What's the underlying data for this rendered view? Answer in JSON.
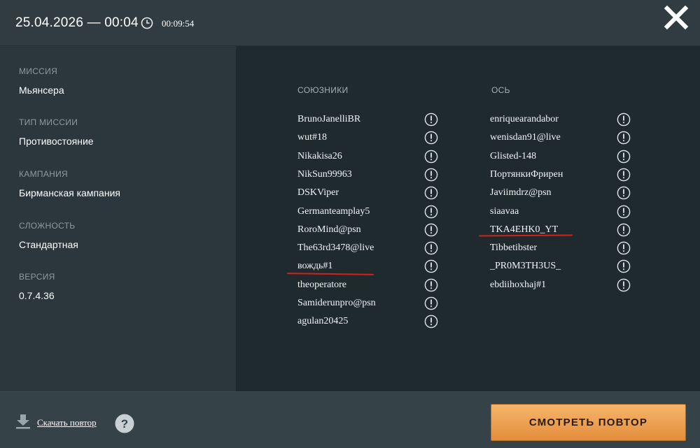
{
  "header": {
    "datetime": "25.04.2026 — 00:04",
    "duration": "00:09:54"
  },
  "info": [
    {
      "label": "МИССИЯ",
      "value": "Мьянсера"
    },
    {
      "label": "ТИП МИССИИ",
      "value": "Противостояние"
    },
    {
      "label": "КАМПАНИЯ",
      "value": "Бирманская кампания"
    },
    {
      "label": "СЛОЖНОСТЬ",
      "value": "Стандартная"
    },
    {
      "label": "ВЕРСИЯ",
      "value": "0.7.4.36"
    }
  ],
  "allies": {
    "title": "СОЮЗНИКИ",
    "players": [
      "BrunoJanelliBR",
      "wut#18",
      "Nikakisa26",
      "NikSun99963",
      "DSKViper",
      "Germanteamplay5",
      "RoroMind@psn",
      "The63rd3478@live",
      "вождь#1",
      "theoperatore",
      "Samiderunpro@psn",
      "agulan20425"
    ]
  },
  "axis": {
    "title": "ОСЬ",
    "players": [
      "enriquearandabor",
      "wenisdan91@live",
      "Glisted-148",
      "ПортянкиФрирен",
      "Javiimdrz@psn",
      "siaavaa",
      "TKA4EHK0_YT",
      "Tibbetibster",
      "_PR0M3TH3US_",
      "ebdiihoxhaj#1"
    ]
  },
  "footer": {
    "download_label": "Скачать повтор",
    "watch_label": "СМОТРЕТЬ ПОВТОР"
  },
  "colors": {
    "accent": "#e9994a",
    "annotation": "#d0211d"
  }
}
